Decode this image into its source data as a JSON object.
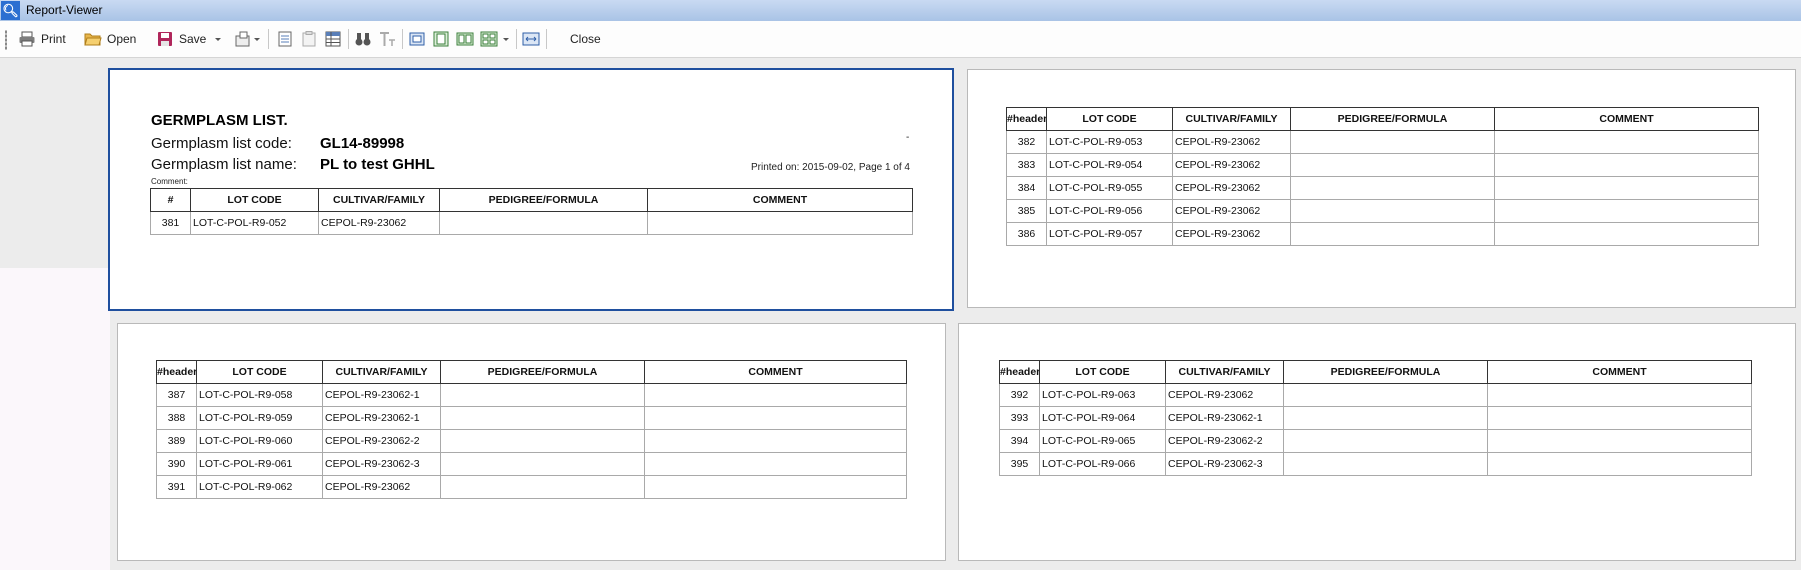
{
  "window": {
    "title": "Report-Viewer"
  },
  "toolbar": {
    "print_label": "Print",
    "open_label": "Open",
    "save_label": "Save",
    "close_label": "Close"
  },
  "report": {
    "title": "GERMPLASM LIST.",
    "code_label": "Germplasm list code:",
    "code_value": "GL14-89998",
    "name_label": "Germplasm list name:",
    "name_value": "PL to test GHHL",
    "comment_label": "Comment:",
    "dash": "-",
    "printed_on": "Printed on: 2015-09-02, Page 1 of 4"
  },
  "columns_first": [
    "#",
    "LOT CODE",
    "CULTIVAR/FAMILY",
    "PEDIGREE/FORMULA",
    "COMMENT"
  ],
  "columns_other": [
    "#header",
    "LOT CODE",
    "CULTIVAR/FAMILY",
    "PEDIGREE/FORMULA",
    "COMMENT"
  ],
  "pages": [
    {
      "rows": [
        [
          "381",
          "LOT-C-POL-R9-052",
          "CEPOL-R9-23062",
          "",
          ""
        ]
      ]
    },
    {
      "rows": [
        [
          "382",
          "LOT-C-POL-R9-053",
          "CEPOL-R9-23062",
          "",
          ""
        ],
        [
          "383",
          "LOT-C-POL-R9-054",
          "CEPOL-R9-23062",
          "",
          ""
        ],
        [
          "384",
          "LOT-C-POL-R9-055",
          "CEPOL-R9-23062",
          "",
          ""
        ],
        [
          "385",
          "LOT-C-POL-R9-056",
          "CEPOL-R9-23062",
          "",
          ""
        ],
        [
          "386",
          "LOT-C-POL-R9-057",
          "CEPOL-R9-23062",
          "",
          ""
        ]
      ]
    },
    {
      "rows": [
        [
          "387",
          "LOT-C-POL-R9-058",
          "CEPOL-R9-23062-1",
          "",
          ""
        ],
        [
          "388",
          "LOT-C-POL-R9-059",
          "CEPOL-R9-23062-1",
          "",
          ""
        ],
        [
          "389",
          "LOT-C-POL-R9-060",
          "CEPOL-R9-23062-2",
          "",
          ""
        ],
        [
          "390",
          "LOT-C-POL-R9-061",
          "CEPOL-R9-23062-3",
          "",
          ""
        ],
        [
          "391",
          "LOT-C-POL-R9-062",
          "CEPOL-R9-23062",
          "",
          ""
        ]
      ]
    },
    {
      "rows": [
        [
          "392",
          "LOT-C-POL-R9-063",
          "CEPOL-R9-23062",
          "",
          ""
        ],
        [
          "393",
          "LOT-C-POL-R9-064",
          "CEPOL-R9-23062-1",
          "",
          ""
        ],
        [
          "394",
          "LOT-C-POL-R9-065",
          "CEPOL-R9-23062-2",
          "",
          ""
        ],
        [
          "395",
          "LOT-C-POL-R9-066",
          "CEPOL-R9-23062-3",
          "",
          ""
        ]
      ]
    }
  ]
}
